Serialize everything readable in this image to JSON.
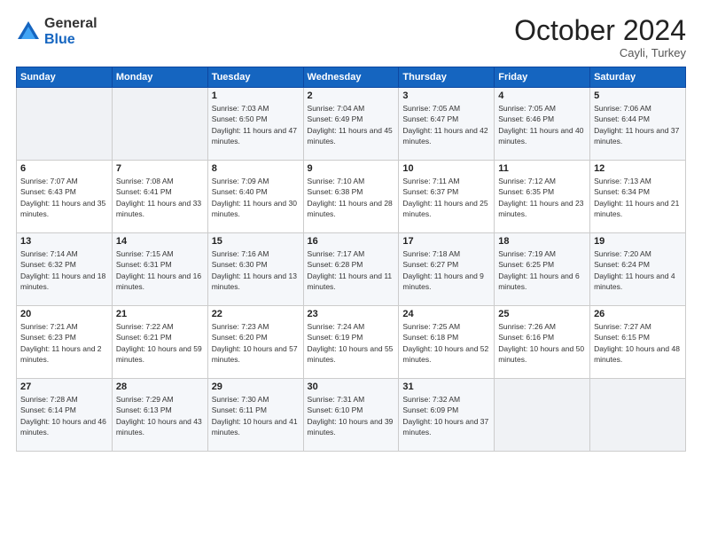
{
  "logo": {
    "general": "General",
    "blue": "Blue"
  },
  "header": {
    "month": "October 2024",
    "location": "Cayli, Turkey"
  },
  "weekdays": [
    "Sunday",
    "Monday",
    "Tuesday",
    "Wednesday",
    "Thursday",
    "Friday",
    "Saturday"
  ],
  "weeks": [
    [
      {
        "day": "",
        "info": ""
      },
      {
        "day": "",
        "info": ""
      },
      {
        "day": "1",
        "info": "Sunrise: 7:03 AM\nSunset: 6:50 PM\nDaylight: 11 hours and 47 minutes."
      },
      {
        "day": "2",
        "info": "Sunrise: 7:04 AM\nSunset: 6:49 PM\nDaylight: 11 hours and 45 minutes."
      },
      {
        "day": "3",
        "info": "Sunrise: 7:05 AM\nSunset: 6:47 PM\nDaylight: 11 hours and 42 minutes."
      },
      {
        "day": "4",
        "info": "Sunrise: 7:05 AM\nSunset: 6:46 PM\nDaylight: 11 hours and 40 minutes."
      },
      {
        "day": "5",
        "info": "Sunrise: 7:06 AM\nSunset: 6:44 PM\nDaylight: 11 hours and 37 minutes."
      }
    ],
    [
      {
        "day": "6",
        "info": "Sunrise: 7:07 AM\nSunset: 6:43 PM\nDaylight: 11 hours and 35 minutes."
      },
      {
        "day": "7",
        "info": "Sunrise: 7:08 AM\nSunset: 6:41 PM\nDaylight: 11 hours and 33 minutes."
      },
      {
        "day": "8",
        "info": "Sunrise: 7:09 AM\nSunset: 6:40 PM\nDaylight: 11 hours and 30 minutes."
      },
      {
        "day": "9",
        "info": "Sunrise: 7:10 AM\nSunset: 6:38 PM\nDaylight: 11 hours and 28 minutes."
      },
      {
        "day": "10",
        "info": "Sunrise: 7:11 AM\nSunset: 6:37 PM\nDaylight: 11 hours and 25 minutes."
      },
      {
        "day": "11",
        "info": "Sunrise: 7:12 AM\nSunset: 6:35 PM\nDaylight: 11 hours and 23 minutes."
      },
      {
        "day": "12",
        "info": "Sunrise: 7:13 AM\nSunset: 6:34 PM\nDaylight: 11 hours and 21 minutes."
      }
    ],
    [
      {
        "day": "13",
        "info": "Sunrise: 7:14 AM\nSunset: 6:32 PM\nDaylight: 11 hours and 18 minutes."
      },
      {
        "day": "14",
        "info": "Sunrise: 7:15 AM\nSunset: 6:31 PM\nDaylight: 11 hours and 16 minutes."
      },
      {
        "day": "15",
        "info": "Sunrise: 7:16 AM\nSunset: 6:30 PM\nDaylight: 11 hours and 13 minutes."
      },
      {
        "day": "16",
        "info": "Sunrise: 7:17 AM\nSunset: 6:28 PM\nDaylight: 11 hours and 11 minutes."
      },
      {
        "day": "17",
        "info": "Sunrise: 7:18 AM\nSunset: 6:27 PM\nDaylight: 11 hours and 9 minutes."
      },
      {
        "day": "18",
        "info": "Sunrise: 7:19 AM\nSunset: 6:25 PM\nDaylight: 11 hours and 6 minutes."
      },
      {
        "day": "19",
        "info": "Sunrise: 7:20 AM\nSunset: 6:24 PM\nDaylight: 11 hours and 4 minutes."
      }
    ],
    [
      {
        "day": "20",
        "info": "Sunrise: 7:21 AM\nSunset: 6:23 PM\nDaylight: 11 hours and 2 minutes."
      },
      {
        "day": "21",
        "info": "Sunrise: 7:22 AM\nSunset: 6:21 PM\nDaylight: 10 hours and 59 minutes."
      },
      {
        "day": "22",
        "info": "Sunrise: 7:23 AM\nSunset: 6:20 PM\nDaylight: 10 hours and 57 minutes."
      },
      {
        "day": "23",
        "info": "Sunrise: 7:24 AM\nSunset: 6:19 PM\nDaylight: 10 hours and 55 minutes."
      },
      {
        "day": "24",
        "info": "Sunrise: 7:25 AM\nSunset: 6:18 PM\nDaylight: 10 hours and 52 minutes."
      },
      {
        "day": "25",
        "info": "Sunrise: 7:26 AM\nSunset: 6:16 PM\nDaylight: 10 hours and 50 minutes."
      },
      {
        "day": "26",
        "info": "Sunrise: 7:27 AM\nSunset: 6:15 PM\nDaylight: 10 hours and 48 minutes."
      }
    ],
    [
      {
        "day": "27",
        "info": "Sunrise: 7:28 AM\nSunset: 6:14 PM\nDaylight: 10 hours and 46 minutes."
      },
      {
        "day": "28",
        "info": "Sunrise: 7:29 AM\nSunset: 6:13 PM\nDaylight: 10 hours and 43 minutes."
      },
      {
        "day": "29",
        "info": "Sunrise: 7:30 AM\nSunset: 6:11 PM\nDaylight: 10 hours and 41 minutes."
      },
      {
        "day": "30",
        "info": "Sunrise: 7:31 AM\nSunset: 6:10 PM\nDaylight: 10 hours and 39 minutes."
      },
      {
        "day": "31",
        "info": "Sunrise: 7:32 AM\nSunset: 6:09 PM\nDaylight: 10 hours and 37 minutes."
      },
      {
        "day": "",
        "info": ""
      },
      {
        "day": "",
        "info": ""
      }
    ]
  ]
}
